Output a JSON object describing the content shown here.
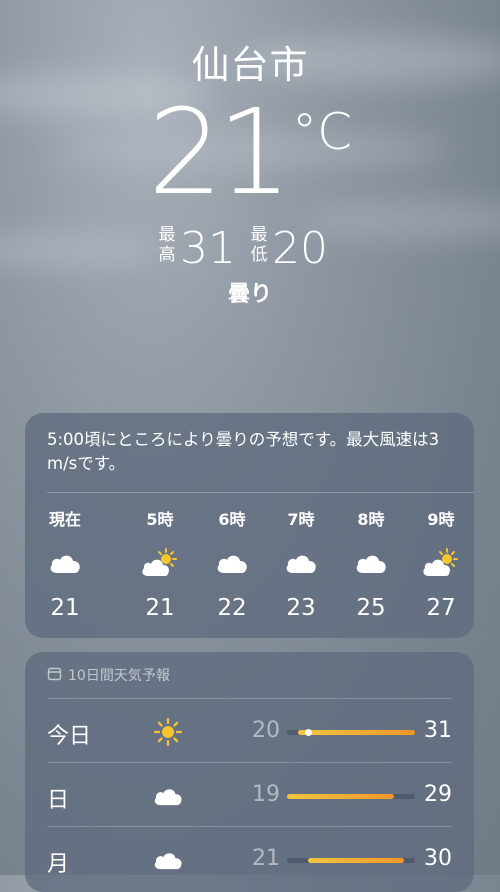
{
  "location": {
    "city": "仙台市"
  },
  "current": {
    "temp": "21",
    "unit": "°C",
    "high_label": "最高",
    "high": "31",
    "low_label": "最低",
    "low": "20",
    "condition": "曇り"
  },
  "hourly": {
    "summary": "5:00頃にところにより曇りの予想です。最大風速は3 m/sです。",
    "items": [
      {
        "label": "現在",
        "icon": "cloud-icon",
        "temp": "21"
      },
      {
        "label": "5時",
        "icon": "partly-sunny-icon",
        "temp": "21"
      },
      {
        "label": "6時",
        "icon": "cloud-icon",
        "temp": "22"
      },
      {
        "label": "7時",
        "icon": "cloud-icon",
        "temp": "23"
      },
      {
        "label": "8時",
        "icon": "cloud-icon",
        "temp": "25"
      },
      {
        "label": "9時",
        "icon": "partly-sunny-icon",
        "temp": "27"
      }
    ]
  },
  "daily": {
    "title": "10日間天気予報",
    "range": [
      19,
      31
    ],
    "days": [
      {
        "name": "今日",
        "icon": "sun-icon",
        "low": "20",
        "high": "31",
        "low_val": 20,
        "high_val": 31,
        "current": 21
      },
      {
        "name": "日",
        "icon": "cloud-icon",
        "low": "19",
        "high": "29",
        "low_val": 19,
        "high_val": 29
      },
      {
        "name": "月",
        "icon": "cloud-icon",
        "low": "21",
        "high": "30",
        "low_val": 21,
        "high_val": 30
      }
    ]
  },
  "colors": {
    "sun": "#f7c531",
    "bar_start": "#f3c640",
    "bar_end": "#f1962a"
  }
}
